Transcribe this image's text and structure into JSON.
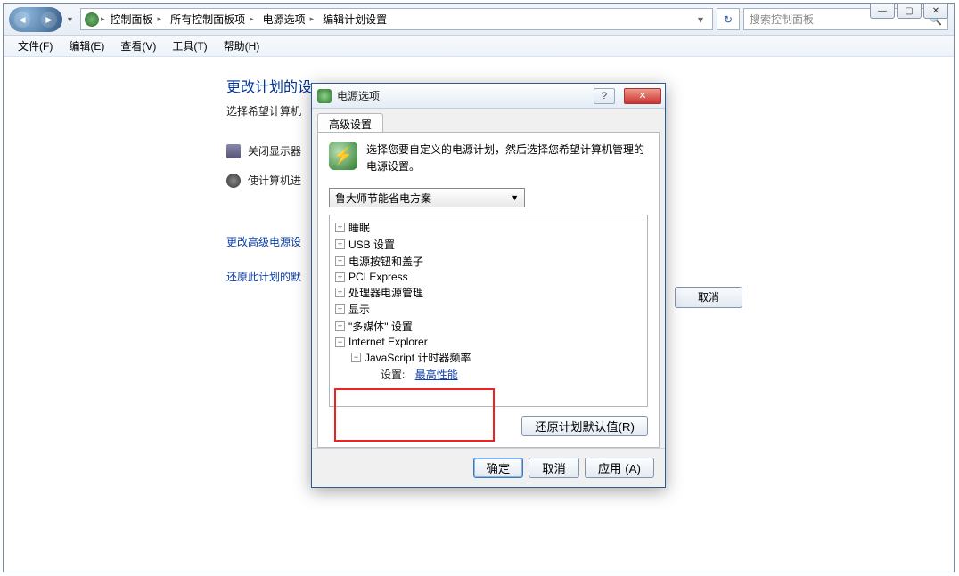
{
  "window_controls": {
    "min": "—",
    "max": "▢",
    "close": "✕"
  },
  "breadcrumb": {
    "items": [
      "控制面板",
      "所有控制面板项",
      "电源选项",
      "编辑计划设置"
    ]
  },
  "search": {
    "placeholder": "搜索控制面板"
  },
  "menu": {
    "file": "文件(F)",
    "edit": "编辑(E)",
    "view": "查看(V)",
    "tools": "工具(T)",
    "help": "帮助(H)"
  },
  "main": {
    "title": "更改计划的设",
    "subtitle": "选择希望计算机",
    "row1": "关闭显示器",
    "row2": "使计算机进",
    "link1": "更改高级电源设",
    "link2": "还原此计划的默",
    "cancel": "取消"
  },
  "dialog": {
    "title": "电源选项",
    "tab": "高级设置",
    "description": "选择您要自定义的电源计划，然后选择您希望计算机管理的电源设置。",
    "plan_selected": "鲁大师节能省电方案",
    "tree": {
      "sleep": "睡眠",
      "usb": "USB 设置",
      "power_button": "电源按钮和盖子",
      "pci": "PCI Express",
      "processor": "处理器电源管理",
      "display": "显示",
      "multimedia": "\"多媒体\" 设置",
      "ie": "Internet Explorer",
      "js_timer": "JavaScript 计时器频率",
      "setting_label": "设置:",
      "setting_value": "最高性能"
    },
    "restore": "还原计划默认值(R)",
    "ok": "确定",
    "cancel": "取消",
    "apply": "应用 (A)"
  }
}
